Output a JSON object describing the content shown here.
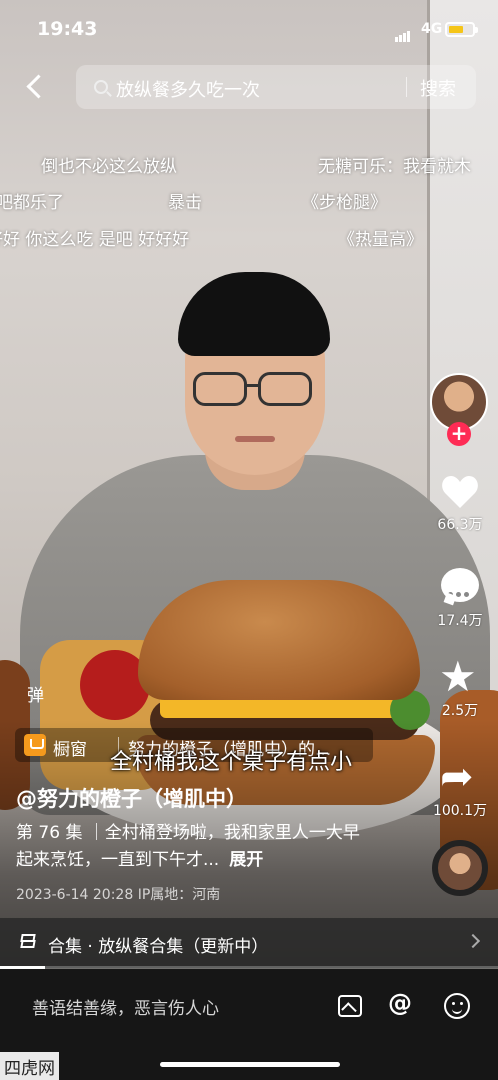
{
  "status_bar": {
    "time": "19:43",
    "network": "4G"
  },
  "search": {
    "query": "放纵餐多久吃一次",
    "button": "搜索"
  },
  "danmaku": [
    "倒也不必这么放纵",
    "无糖可乐：我看就木",
    "吧都乐了",
    "暴击",
    "《步枪腿》",
    "好好 你这么吃 是吧 好好好",
    "《热量高》"
  ],
  "sidebar": {
    "likes": "66.3万",
    "comments": "17.4万",
    "favorites": "2.5万",
    "shares": "100.1万"
  },
  "video": {
    "danmu_toggle": "弹",
    "shop_label": "橱窗",
    "shop_title": "努力的橙子（增肌中）的...",
    "subtitle": "全村桶我这个桌子有点小",
    "author": "@努力的橙子（增肌中）",
    "description": "第 76 集 ｜全村桶登场啦，我和家里人一大早起来烹饪，一直到下午才...",
    "expand": "展开",
    "meta": "2023-6-14 20:28 IP属地：河南"
  },
  "collection": {
    "label": "合集 · 放纵餐合集（更新中）",
    "progress": 0.09
  },
  "comment_bar": {
    "placeholder": "善语结善缘，恶言伤人心"
  },
  "watermark": "四虎网"
}
